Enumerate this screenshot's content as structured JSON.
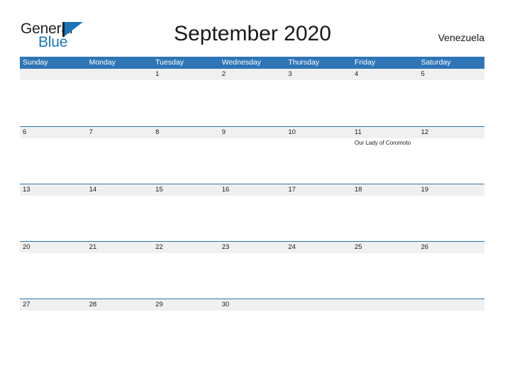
{
  "brand": {
    "name_part1": "General",
    "name_part2": "Blue",
    "flag_icon": "flag-triangle-icon"
  },
  "header": {
    "title": "September 2020",
    "country": "Venezuela"
  },
  "colors": {
    "header_blue": "#2e75b6",
    "brand_blue": "#1b75bc",
    "band_gray": "#f0f0f0",
    "text_dark": "#1a1a1a"
  },
  "calendar": {
    "weekdays": [
      "Sunday",
      "Monday",
      "Tuesday",
      "Wednesday",
      "Thursday",
      "Friday",
      "Saturday"
    ],
    "weeks": [
      [
        {
          "day": "",
          "events": []
        },
        {
          "day": "",
          "events": []
        },
        {
          "day": "1",
          "events": []
        },
        {
          "day": "2",
          "events": []
        },
        {
          "day": "3",
          "events": []
        },
        {
          "day": "4",
          "events": []
        },
        {
          "day": "5",
          "events": []
        }
      ],
      [
        {
          "day": "6",
          "events": []
        },
        {
          "day": "7",
          "events": []
        },
        {
          "day": "8",
          "events": []
        },
        {
          "day": "9",
          "events": []
        },
        {
          "day": "10",
          "events": []
        },
        {
          "day": "11",
          "events": [
            "Our Lady of Coromoto"
          ]
        },
        {
          "day": "12",
          "events": []
        }
      ],
      [
        {
          "day": "13",
          "events": []
        },
        {
          "day": "14",
          "events": []
        },
        {
          "day": "15",
          "events": []
        },
        {
          "day": "16",
          "events": []
        },
        {
          "day": "17",
          "events": []
        },
        {
          "day": "18",
          "events": []
        },
        {
          "day": "19",
          "events": []
        }
      ],
      [
        {
          "day": "20",
          "events": []
        },
        {
          "day": "21",
          "events": []
        },
        {
          "day": "22",
          "events": []
        },
        {
          "day": "23",
          "events": []
        },
        {
          "day": "24",
          "events": []
        },
        {
          "day": "25",
          "events": []
        },
        {
          "day": "26",
          "events": []
        }
      ],
      [
        {
          "day": "27",
          "events": []
        },
        {
          "day": "28",
          "events": []
        },
        {
          "day": "29",
          "events": []
        },
        {
          "day": "30",
          "events": []
        },
        {
          "day": "",
          "events": []
        },
        {
          "day": "",
          "events": []
        },
        {
          "day": "",
          "events": []
        }
      ]
    ]
  }
}
